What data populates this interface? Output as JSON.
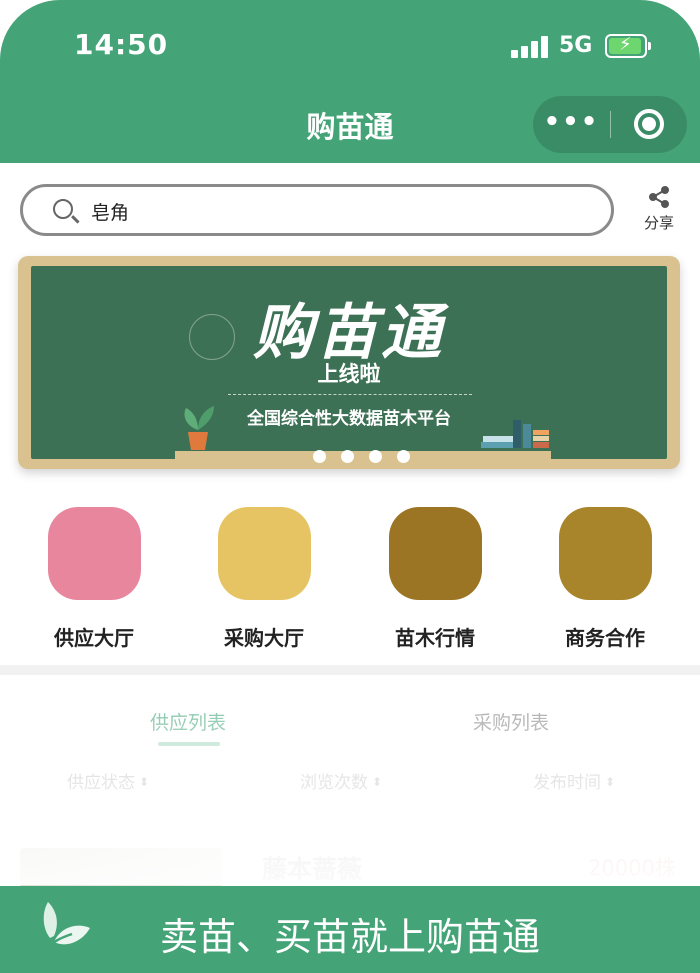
{
  "status_bar": {
    "time": "14:50",
    "network": "5G"
  },
  "header": {
    "title": "购苗通",
    "more_icon": "more-dots-icon",
    "target_icon": "target-icon"
  },
  "search": {
    "value": "皂角",
    "icon": "search-icon"
  },
  "share": {
    "label": "分享",
    "icon": "share-icon"
  },
  "banner": {
    "title": "购苗通",
    "subtitle": "上线啦",
    "description": "全国综合性大数据苗木平台",
    "slides": 4
  },
  "categories": [
    {
      "label": "供应大厅",
      "color": "#e8869e"
    },
    {
      "label": "采购大厅",
      "color": "#e7c463"
    },
    {
      "label": "苗木行情",
      "color": "#9b7424"
    },
    {
      "label": "商务合作",
      "color": "#a8852b"
    }
  ],
  "tabs": [
    {
      "label": "供应列表",
      "active": true
    },
    {
      "label": "采购列表",
      "active": false
    }
  ],
  "sort_options": [
    {
      "label": "供应状态"
    },
    {
      "label": "浏览次数"
    },
    {
      "label": "发布时间"
    }
  ],
  "listing": {
    "name": "藤本蔷薇",
    "quantity": "20000株"
  },
  "footer": {
    "text": "卖苗、买苗就上购苗通",
    "icon": "leaf-icon"
  },
  "colors": {
    "brand": "#44a477",
    "tab_active": "#6ab896"
  }
}
